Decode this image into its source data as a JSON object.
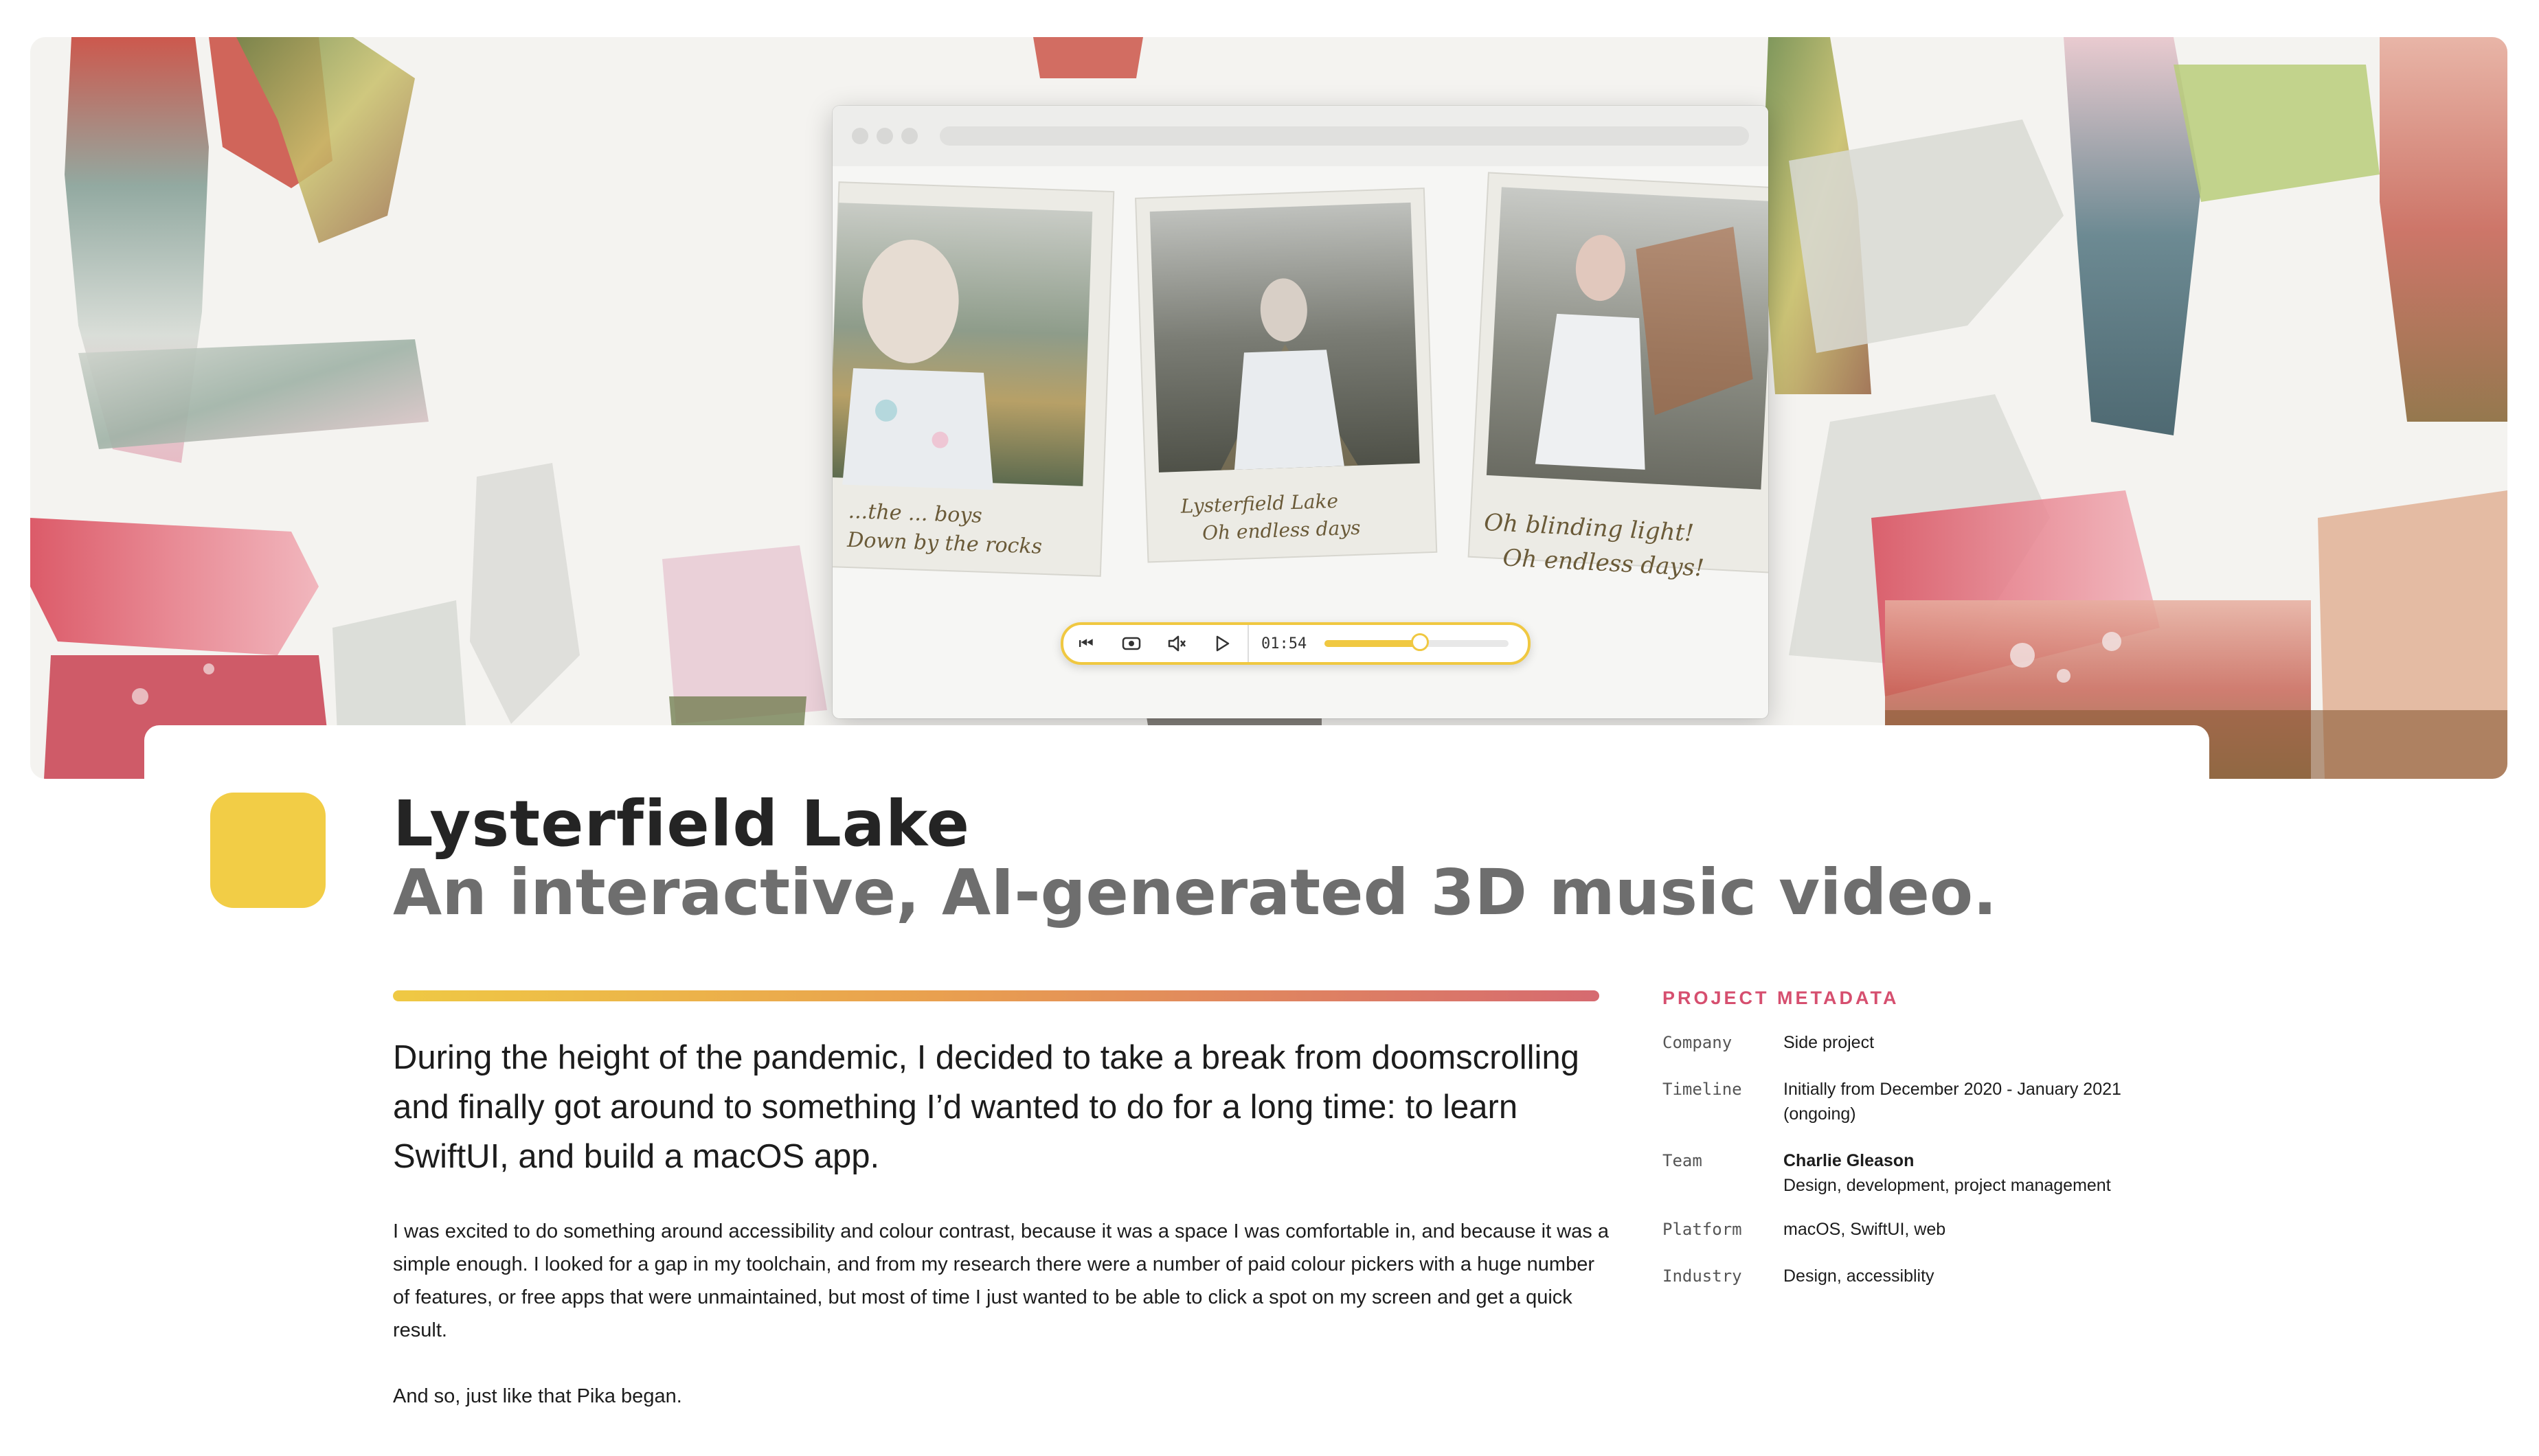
{
  "hero": {
    "player": {
      "time": "01:54",
      "progress": 0.52,
      "buttons": [
        "skip-back",
        "camera",
        "mute",
        "play"
      ]
    },
    "polaroid_captions": [
      [
        "...the ... boys",
        "Down by the rocks"
      ],
      [
        "Lysterfield Lake",
        "Oh endless days"
      ],
      [
        "Oh blinding light!",
        "Oh endless days!"
      ]
    ]
  },
  "project": {
    "title": "Lysterfield Lake",
    "subtitle": "An interactive, AI-generated 3D music video.",
    "icon_color": "#f2cd46"
  },
  "article": {
    "lead": "During the height of the pandemic, I decided to take a break from doomscrolling and finally got around to something I’d wanted to do for a long time: to learn SwiftUI, and build a macOS app.",
    "p1": "I was excited to do something around accessibility and colour contrast, because it was a space I was comfortable in, and because it was a simple enough. I looked for a gap in my toolchain, and from my research there were a number of paid colour pickers with a huge number of features, or free apps that were unmaintained, but most of time I just wanted to be able to click a spot on my screen and get a quick result.",
    "p2": "And so, just like that Pika began."
  },
  "metadata": {
    "heading": "PROJECT METADATA",
    "company": {
      "key": "Company",
      "value": "Side project"
    },
    "timeline": {
      "key": "Timeline",
      "value_line1": "Initially from December 2020  - January 2021",
      "value_line2": "(ongoing)"
    },
    "team": {
      "key": "Team",
      "name": "Charlie Gleason",
      "roles": "Design, development, project management"
    },
    "platform": {
      "key": "Platform",
      "value": "macOS, SwiftUI, web"
    },
    "industry": {
      "key": "Industry",
      "value": "Design, accessiblity"
    }
  },
  "colors": {
    "accent_yellow": "#f0c841",
    "accent_pink": "#d64f6f",
    "gradient": [
      "#efc944",
      "#e9a04f",
      "#d66a70"
    ]
  }
}
